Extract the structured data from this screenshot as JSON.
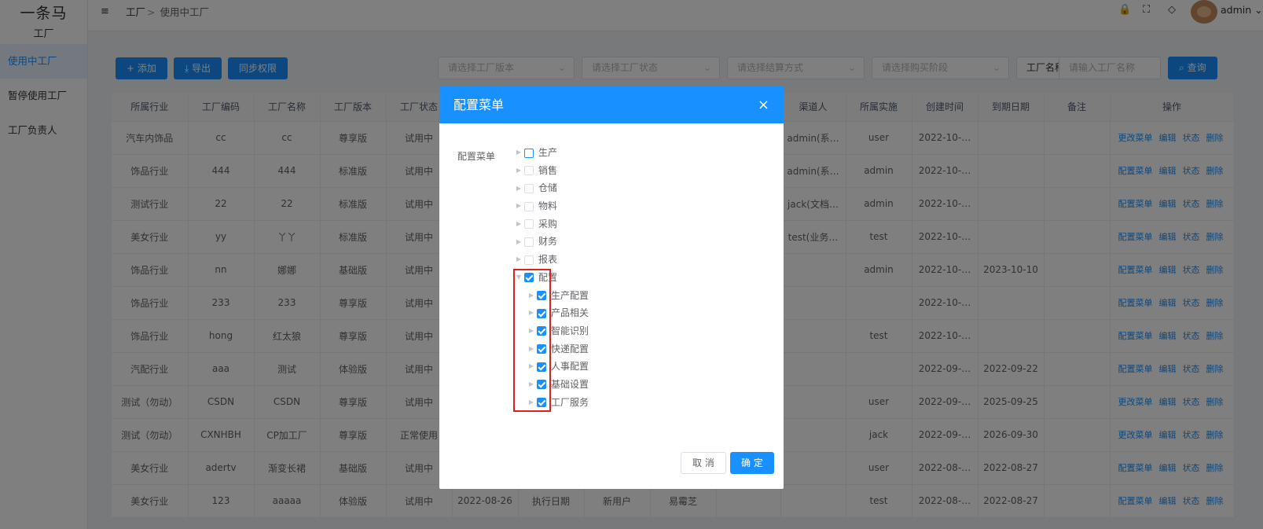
{
  "app": {
    "logo_line1": "一条马",
    "logo_line2": "工厂"
  },
  "sidebar": {
    "items": [
      {
        "label": "使用中工厂"
      },
      {
        "label": "暂停使用工厂"
      },
      {
        "label": "工厂负责人"
      }
    ]
  },
  "header": {
    "collapse_icon": "≡",
    "breadcrumb": {
      "home": "工厂",
      "sep": ">",
      "current": "使用中工厂"
    },
    "icons": {
      "lock": "🔒",
      "fullscreen": "⛶",
      "theme": "◇"
    },
    "user": "admin"
  },
  "toolbar": {
    "add": "+ 添加",
    "export": "⤓ 导出",
    "sync": "同步权限"
  },
  "filters": {
    "version": "请选择工厂版本",
    "status": "请选择工厂状态",
    "settle": "请选择结算方式",
    "stage": "请选择购买阶段",
    "name_type": "工厂名称",
    "name_input": "请输入工厂名称",
    "search": "查询"
  },
  "table": {
    "columns": [
      "所属行业",
      "工厂编码",
      "工厂名称",
      "工厂版本",
      "工厂状态",
      "",
      "",
      "",
      "",
      "",
      "渠道人",
      "所属实施",
      "创建时间",
      "到期日期",
      "备注",
      "操作"
    ],
    "rows": [
      [
        "汽车内饰品",
        "cc",
        "cc",
        "尊享版",
        "试用中",
        "",
        "",
        "",
        "",
        "",
        "admin(系…",
        "user",
        "2022-10-…",
        "",
        "",
        "更改菜单"
      ],
      [
        "饰品行业",
        "444",
        "444",
        "标准版",
        "试用中",
        "",
        "",
        "",
        "",
        "",
        "admin(系…",
        "admin",
        "2022-10-…",
        "",
        "",
        "配置菜单"
      ],
      [
        "测试行业",
        "22",
        "22",
        "标准版",
        "试用中",
        "",
        "",
        "",
        "",
        "",
        "jack(文档…",
        "admin",
        "2022-10-…",
        "",
        "",
        "配置菜单"
      ],
      [
        "美女行业",
        "yy",
        "丫丫",
        "标准版",
        "试用中",
        "",
        "",
        "",
        "",
        "",
        "test(业务…",
        "test",
        "2022-10-…",
        "",
        "",
        "配置菜单"
      ],
      [
        "饰品行业",
        "nn",
        "娜娜",
        "基础版",
        "试用中",
        "",
        "",
        "",
        "",
        "",
        "",
        "admin",
        "2022-10-…",
        "2023-10-10",
        "",
        "配置菜单"
      ],
      [
        "饰品行业",
        "233",
        "233",
        "尊享版",
        "试用中",
        "",
        "",
        "",
        "",
        "",
        "",
        "",
        "2022-10-…",
        "",
        "",
        "配置菜单"
      ],
      [
        "饰品行业",
        "hong",
        "红太狼",
        "尊享版",
        "试用中",
        "",
        "",
        "",
        "",
        "",
        "",
        "test",
        "2022-10-…",
        "",
        "",
        "配置菜单"
      ],
      [
        "汽配行业",
        "aaa",
        "测试",
        "体验版",
        "试用中",
        "",
        "",
        "",
        "",
        "",
        "",
        "",
        "2022-09-…",
        "2022-09-22",
        "",
        "配置菜单"
      ],
      [
        "测试（勿动）",
        "CSDN",
        "CSDN",
        "尊享版",
        "试用中",
        "",
        "",
        "",
        "",
        "",
        "",
        "user",
        "2022-09-…",
        "2025-09-25",
        "",
        "更改菜单"
      ],
      [
        "测试（勿动）",
        "CXNHBH",
        "CP加工厂",
        "尊享版",
        "正常使用",
        "",
        "",
        "",
        "",
        "",
        "",
        "jack",
        "2022-09-…",
        "2026-09-30",
        "",
        "更改菜单"
      ],
      [
        "美女行业",
        "adertv",
        "渐变长裙",
        "基础版",
        "试用中",
        "",
        "",
        "",
        "",
        "",
        "",
        "user",
        "2022-08-…",
        "2022-08-27",
        "",
        "配置菜单"
      ],
      [
        "美女行业",
        "123",
        "aaaaa",
        "体验版",
        "试用中",
        "2022-08-26",
        "执行日期",
        "新用户",
        "易霉芝",
        "",
        "",
        "test",
        "2022-08-…",
        "2022-08-27",
        "",
        "配置菜单"
      ]
    ],
    "ops": {
      "edit": "编辑",
      "status": "状态",
      "delete": "删除"
    }
  },
  "modal": {
    "title": "配置菜单",
    "close": "×",
    "label": "配置菜单",
    "tree": [
      {
        "label": "生产",
        "checked": false
      },
      {
        "label": "销售",
        "checked": false
      },
      {
        "label": "仓储",
        "checked": false
      },
      {
        "label": "物料",
        "checked": false
      },
      {
        "label": "采购",
        "checked": false
      },
      {
        "label": "财务",
        "checked": false
      },
      {
        "label": "报表",
        "checked": false
      },
      {
        "label": "配置",
        "checked": true,
        "expanded": true,
        "children": [
          {
            "label": "生产配置",
            "checked": true
          },
          {
            "label": "产品相关",
            "checked": true
          },
          {
            "label": "智能识别",
            "checked": true
          },
          {
            "label": "快递配置",
            "checked": true
          },
          {
            "label": "人事配置",
            "checked": true
          },
          {
            "label": "基础设置",
            "checked": true
          },
          {
            "label": "工厂服务",
            "checked": true
          }
        ]
      }
    ],
    "cancel": "取 消",
    "confirm": "确 定"
  },
  "colors": {
    "primary": "#1890ff",
    "highlight": "#e02020"
  }
}
